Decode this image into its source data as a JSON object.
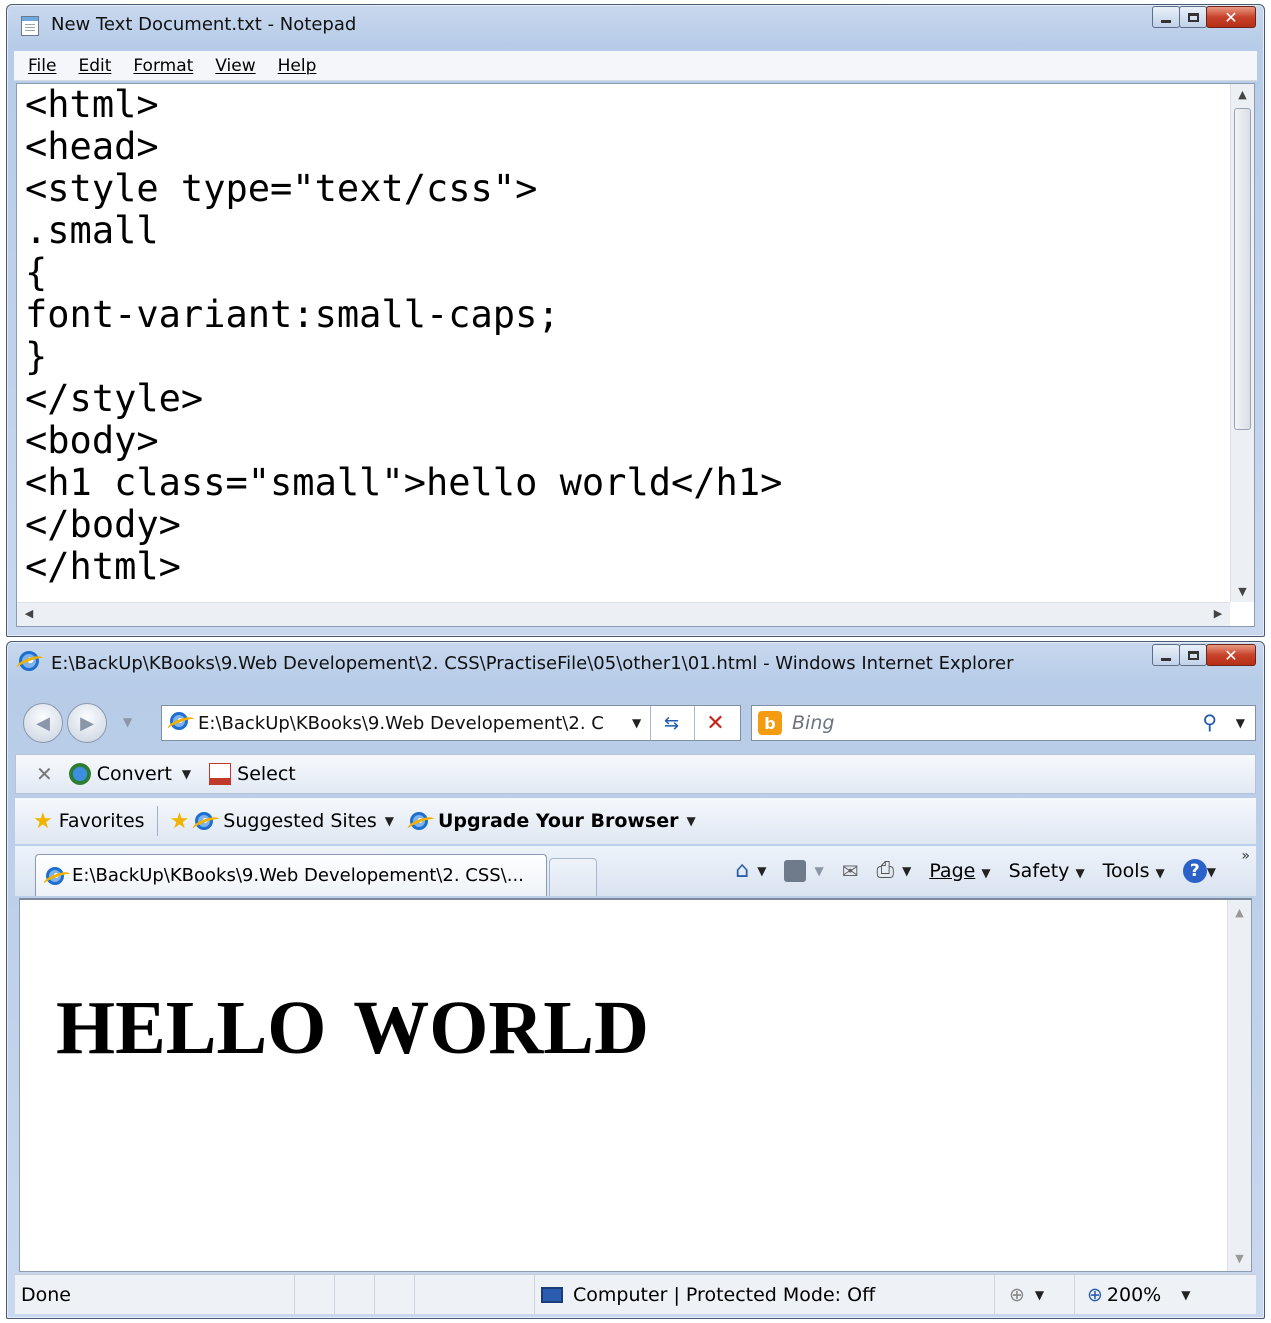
{
  "notepad": {
    "title": "New Text Document.txt - Notepad",
    "menu": [
      "File",
      "Edit",
      "Format",
      "View",
      "Help"
    ],
    "code_lines": [
      "<html>",
      "<head>",
      "<style type=\"text/css\">",
      ".small",
      "{",
      "font-variant:small-caps;",
      "}",
      "</style>",
      "<body>",
      "<h1 class=\"small\">hello world</h1>",
      "</body>",
      "</html>"
    ]
  },
  "ie": {
    "title": "E:\\BackUp\\KBooks\\9.Web Developement\\2. CSS\\PractiseFile\\05\\other1\\01.html - Windows Internet Explorer",
    "address": "E:\\BackUp\\KBooks\\9.Web Developement\\2. C",
    "search_placeholder": "Bing",
    "toolbar": {
      "convert": "Convert",
      "select": "Select"
    },
    "favorites": {
      "favorites": "Favorites",
      "suggested": "Suggested Sites",
      "upgrade": "Upgrade Your Browser"
    },
    "tab_title": "E:\\BackUp\\KBooks\\9.Web Developement\\2. CSS\\...",
    "commands": {
      "page": "Page",
      "safety": "Safety",
      "tools": "Tools"
    },
    "page_heading": "hello world",
    "status": {
      "done": "Done",
      "zone": "Computer | Protected Mode: Off",
      "zoom": "200%"
    }
  }
}
